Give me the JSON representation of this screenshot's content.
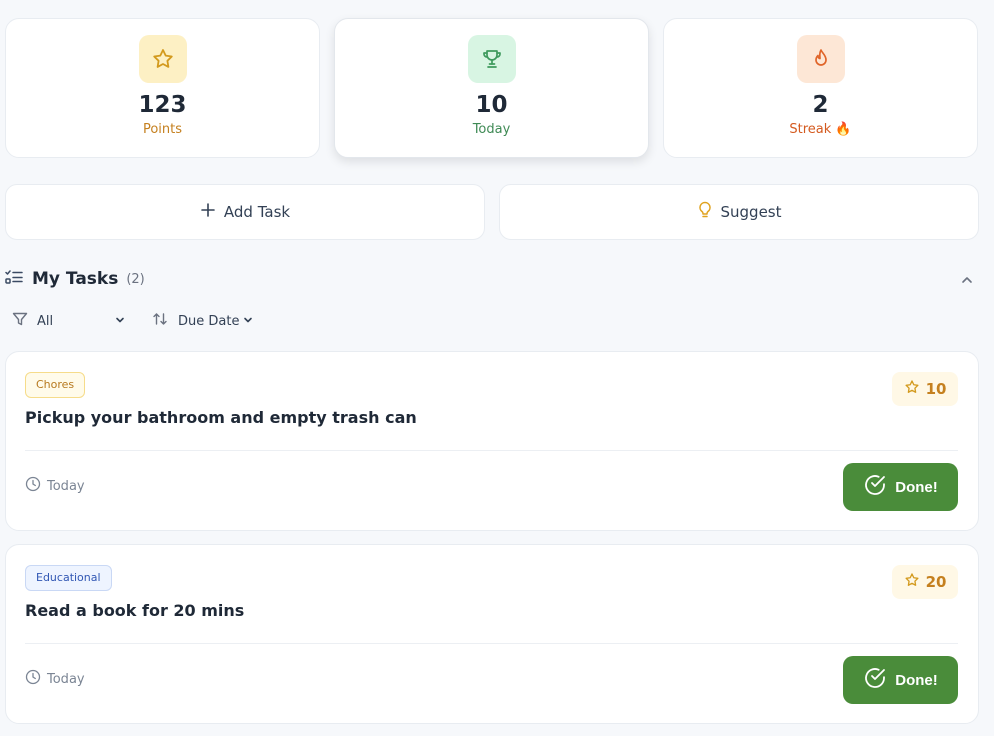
{
  "stats": [
    {
      "value": "123",
      "label": "Points",
      "icon": "star-icon",
      "icon_bg": "#fdf0c4",
      "color": "#c5801f"
    },
    {
      "value": "10",
      "label": "Today",
      "icon": "trophy-icon",
      "icon_bg": "#d8f5e3",
      "color": "#3f8a55"
    },
    {
      "value": "2",
      "label": "Streak 🔥",
      "icon": "flame-icon",
      "icon_bg": "#fde7d6",
      "color": "#d45a1f"
    }
  ],
  "actions": {
    "add_task": "Add Task",
    "suggest": "Suggest"
  },
  "tasks_section": {
    "title": "My Tasks",
    "count": "(2)",
    "filter_value": "All",
    "sort_value": "Due Date"
  },
  "tasks": [
    {
      "category": "Chores",
      "points": "10",
      "title": "Pickup your bathroom and empty trash can",
      "due": "Today",
      "done_label": "Done!"
    },
    {
      "category": "Educational",
      "points": "20",
      "title": "Read a book for 20 mins",
      "due": "Today",
      "done_label": "Done!"
    }
  ],
  "colors": {
    "accent_green": "#4a8c3a",
    "points_gold": "#c5801f"
  }
}
